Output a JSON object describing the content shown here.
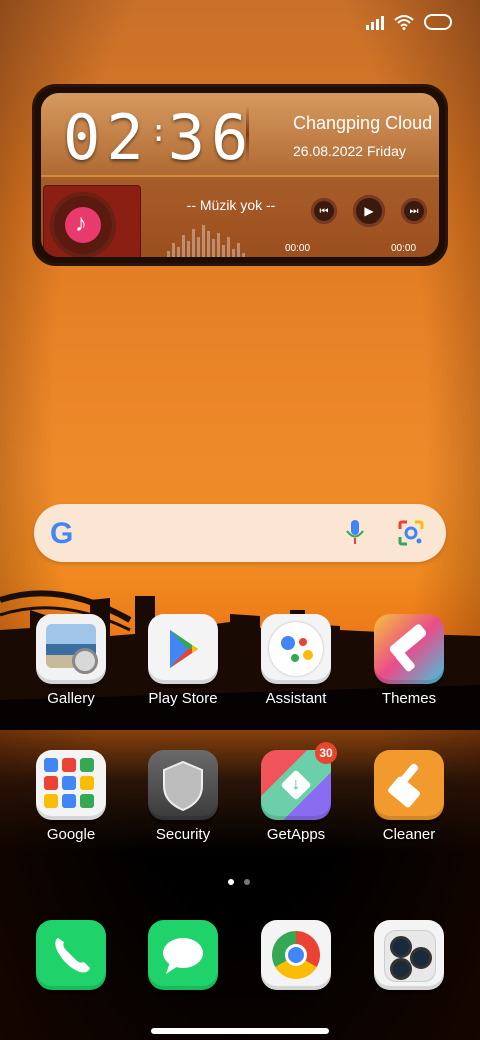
{
  "widget": {
    "clock_hours": "02",
    "clock_minutes": "36",
    "city": "Changping Cloud",
    "date": "26.08.2022 Friday",
    "track": "-- Müzik yok --",
    "time_elapsed": "00:00",
    "time_total": "00:00",
    "progress": 0
  },
  "search": {
    "logo_letter": "G"
  },
  "apps": [
    {
      "label": "Gallery"
    },
    {
      "label": "Play Store"
    },
    {
      "label": "Assistant"
    },
    {
      "label": "Themes"
    },
    {
      "label": "Google"
    },
    {
      "label": "Security"
    },
    {
      "label": "GetApps",
      "badge": "30"
    },
    {
      "label": "Cleaner"
    }
  ],
  "dock": [
    {
      "icon": "phone-icon"
    },
    {
      "icon": "messages-icon"
    },
    {
      "icon": "chrome-icon"
    },
    {
      "icon": "camera-icon"
    }
  ],
  "page_indicator": {
    "current": 1,
    "total": 2
  },
  "colors": {
    "sky_orange": "#ef8a2a",
    "badge_red": "#e8442e",
    "search_bg": "#fbe6d4"
  }
}
